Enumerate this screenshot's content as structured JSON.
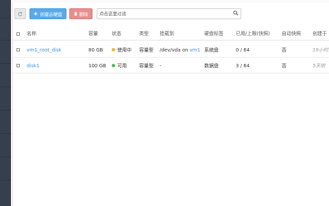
{
  "toolbar": {
    "create_label": "创建云硬盘",
    "delete_label": "删除"
  },
  "search": {
    "placeholder": "点击这里过滤",
    "value": ""
  },
  "table": {
    "headers": {
      "name": "名称",
      "size": "容量",
      "status": "状态",
      "type": "类型",
      "attached": "挂载到",
      "label": "硬盘标签",
      "snap_usage": "已用/上限(快照)",
      "auto_snap": "自动快照",
      "created": "创建于"
    },
    "rows": [
      {
        "name": "vm1_root_disk",
        "size": "80 GB",
        "status": "使用中",
        "status_color": "#f0b428",
        "type": "容量型",
        "attached_prefix": "/dev/vda on ",
        "attached_vm": "vm1",
        "label": "系统盘",
        "snap_usage": "0 / 64",
        "auto_snap": "否",
        "created": "19小时前"
      },
      {
        "name": "disk1",
        "size": "100 GB",
        "status": "可用",
        "status_color": "#4cbb4c",
        "type": "容量型",
        "attached_prefix": "-",
        "attached_vm": "",
        "label": "数据盘",
        "snap_usage": "3 / 64",
        "auto_snap": "否",
        "created": "5天前"
      }
    ]
  },
  "colors": {
    "accent": "#5aaae8",
    "danger": "#e88e8e",
    "sidebar": "#36404c",
    "link": "#3a8ee6"
  },
  "icons": {
    "refresh": "refresh-icon",
    "create": "plus-icon",
    "delete": "trash-icon",
    "search": "search-icon"
  }
}
